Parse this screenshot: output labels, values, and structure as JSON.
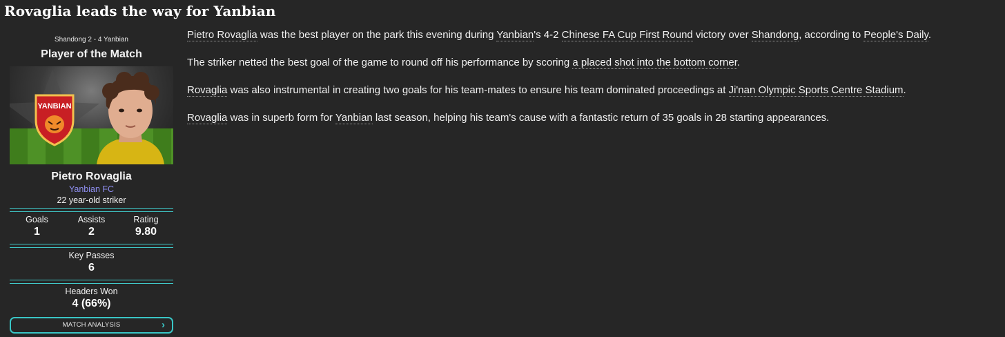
{
  "headline": "Rovaglia leads the way for Yanbian",
  "card": {
    "match_line": "Shandong 2 - 4 Yanbian",
    "title": "Player of the Match",
    "crest_text": "YANBIAN",
    "player_name": "Pietro Rovaglia",
    "club": "Yanbian FC",
    "age_position": "22 year-old striker",
    "stats": {
      "goals_label": "Goals",
      "goals": "1",
      "assists_label": "Assists",
      "assists": "2",
      "rating_label": "Rating",
      "rating": "9.80",
      "key_passes_label": "Key Passes",
      "key_passes": "6",
      "headers_label": "Headers Won",
      "headers": "4 (66%)"
    },
    "button_label": "MATCH ANALYSIS",
    "button_icon": "chevron-right-icon"
  },
  "article": {
    "p1": {
      "a": "Pietro Rovaglia",
      "b": " was the best player on the park this evening during ",
      "c": "Yanbian",
      "d": "'s 4-2 ",
      "e": "Chinese FA Cup First Round",
      "f": " victory over ",
      "g": "Shandong",
      "h": ", according to ",
      "i": "People's Daily",
      "j": "."
    },
    "p2": {
      "a": "The striker netted the best goal of the game to round off his performance by scoring ",
      "b": "a placed shot into the bottom corner",
      "c": "."
    },
    "p3": {
      "a": "Rovaglia",
      "b": " was also instrumental in creating two goals for his team-mates to ensure his team dominated proceedings at ",
      "c": "Ji'nan Olympic Sports Centre Stadium",
      "d": "."
    },
    "p4": {
      "a": "Rovaglia",
      "b": " was in superb form for ",
      "c": "Yanbian",
      "d": " last season, helping his team's cause with a fantastic return of 35 goals in 28 starting appearances."
    }
  },
  "colors": {
    "background": "#262626",
    "accent": "#39c6c6",
    "club_link": "#8e8ef0"
  }
}
